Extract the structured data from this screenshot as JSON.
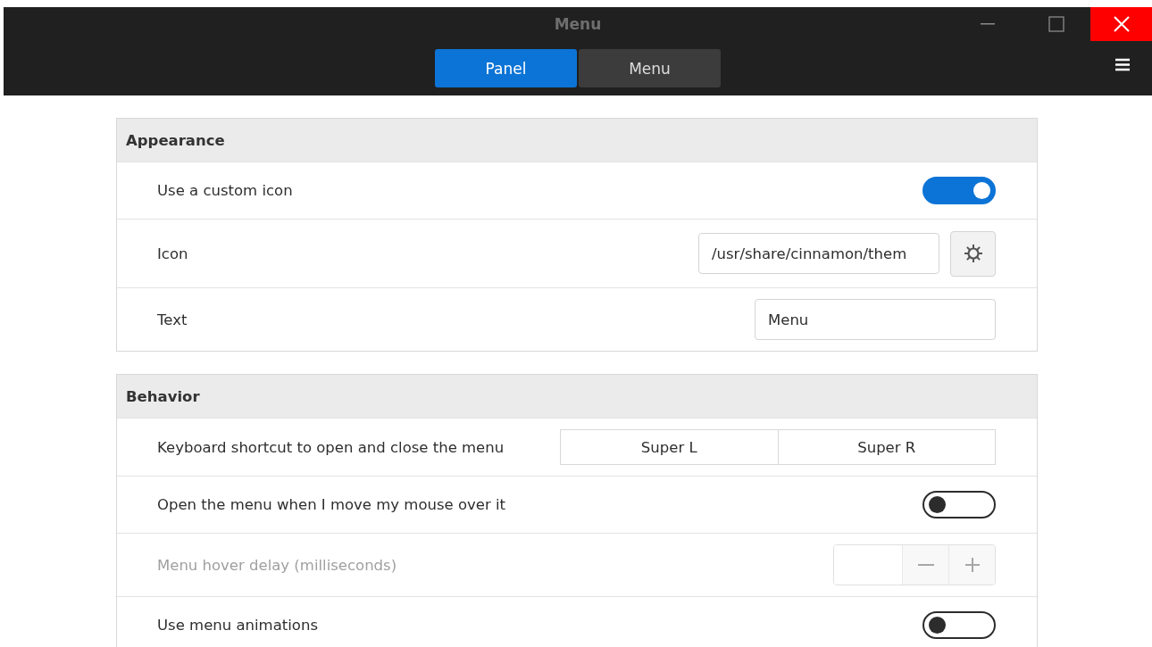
{
  "window": {
    "title": "Menu"
  },
  "tabs": [
    {
      "label": "Panel",
      "selected": true
    },
    {
      "label": "Menu",
      "selected": false
    }
  ],
  "sections": [
    {
      "title": "Appearance",
      "rows": [
        {
          "kind": "switch",
          "label": "Use a custom icon",
          "on": true,
          "disabled": false
        },
        {
          "kind": "icon",
          "label": "Icon",
          "value": "/usr/share/cinnamon/them",
          "disabled": false
        },
        {
          "kind": "entry",
          "label": "Text",
          "value": "Menu",
          "disabled": false
        }
      ]
    },
    {
      "title": "Behavior",
      "rows": [
        {
          "kind": "keybinding",
          "label": "Keyboard shortcut to open and close the menu",
          "keys": [
            "Super L",
            "Super R"
          ],
          "disabled": false
        },
        {
          "kind": "switch",
          "label": "Open the menu when I move my mouse over it",
          "on": false,
          "disabled": false
        },
        {
          "kind": "spin",
          "label": "Menu hover delay (milliseconds)",
          "disabled": true
        },
        {
          "kind": "switch",
          "label": "Use menu animations",
          "on": false,
          "disabled": false
        }
      ]
    }
  ]
}
